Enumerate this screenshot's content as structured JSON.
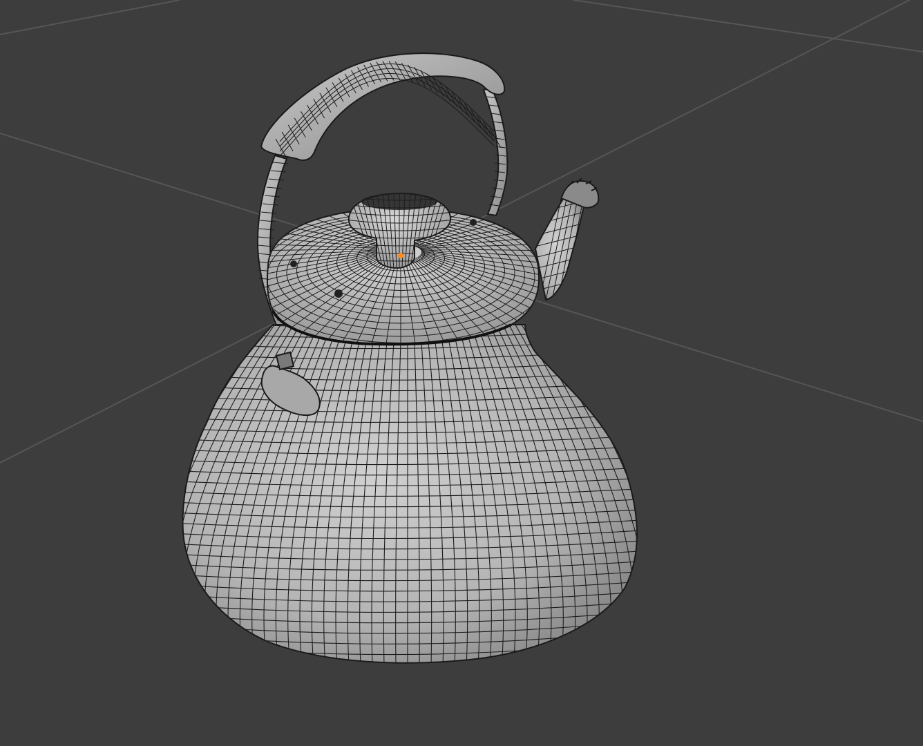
{
  "viewport": {
    "background_color": "#3d3d3d",
    "grid_color": "#555555",
    "object": {
      "type": "kettle",
      "display_mode": "wireframe-on-solid",
      "surface_color": "#b8b8b8",
      "wire_color": "#1a1a1a",
      "origin_color": "#ff8a1a"
    }
  }
}
